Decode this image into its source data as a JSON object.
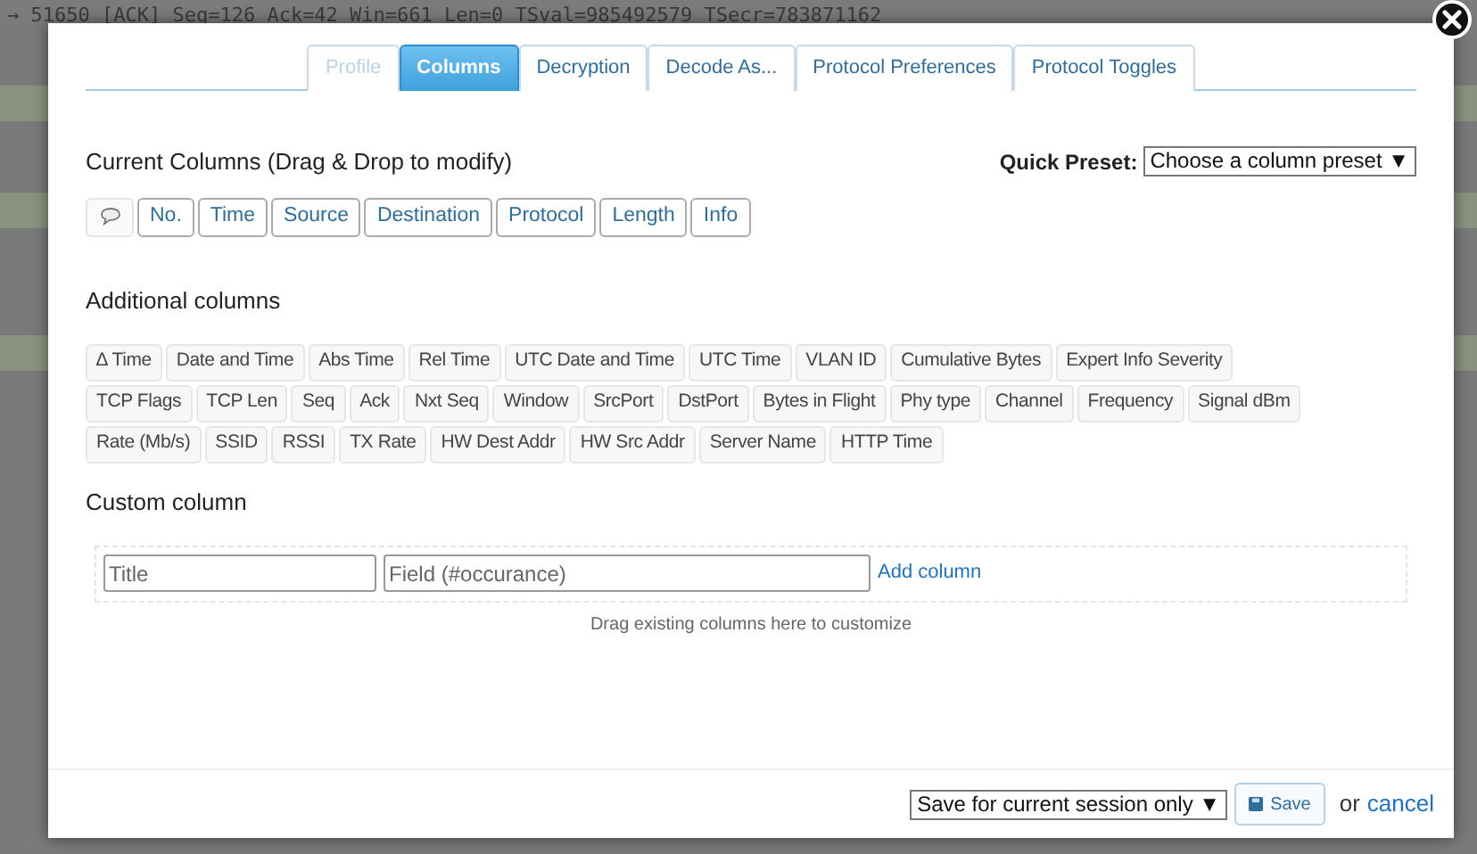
{
  "background": {
    "line": "→ 51650 [ACK] Seq=126 Ack=42 Win=661 Len=0 TSval=985492579 TSecr=783871162"
  },
  "tabs": [
    {
      "label": "Profile",
      "selected": false,
      "disabled": true
    },
    {
      "label": "Columns",
      "selected": true,
      "disabled": false
    },
    {
      "label": "Decryption",
      "selected": false,
      "disabled": false
    },
    {
      "label": "Decode As...",
      "selected": false,
      "disabled": false
    },
    {
      "label": "Protocol Preferences",
      "selected": false,
      "disabled": false
    },
    {
      "label": "Protocol Toggles",
      "selected": false,
      "disabled": false
    }
  ],
  "current_columns": {
    "heading": "Current Columns (Drag & Drop to modify)",
    "quick_preset_label": "Quick Preset:",
    "quick_preset_value": "Choose a column preset ▼",
    "items": [
      "No.",
      "Time",
      "Source",
      "Destination",
      "Protocol",
      "Length",
      "Info"
    ]
  },
  "additional_columns": {
    "heading": "Additional columns",
    "items": [
      "∆ Time",
      "Date and Time",
      "Abs Time",
      "Rel Time",
      "UTC Date and Time",
      "UTC Time",
      "VLAN ID",
      "Cumulative Bytes",
      "Expert Info Severity",
      "TCP Flags",
      "TCP Len",
      "Seq",
      "Ack",
      "Nxt Seq",
      "Window",
      "SrcPort",
      "DstPort",
      "Bytes in Flight",
      "Phy type",
      "Channel",
      "Frequency",
      "Signal dBm",
      "Rate (Mb/s)",
      "SSID",
      "RSSI",
      "TX Rate",
      "HW Dest Addr",
      "HW Src Addr",
      "Server Name",
      "HTTP Time"
    ]
  },
  "custom_column": {
    "heading": "Custom column",
    "title_placeholder": "Title",
    "field_placeholder": "Field (#occurance)",
    "add_link": "Add column",
    "hint": "Drag existing columns here to customize"
  },
  "footer": {
    "save_scope": "Save for current session only ▼",
    "save_button": "Save",
    "or": "or",
    "cancel": "cancel"
  }
}
